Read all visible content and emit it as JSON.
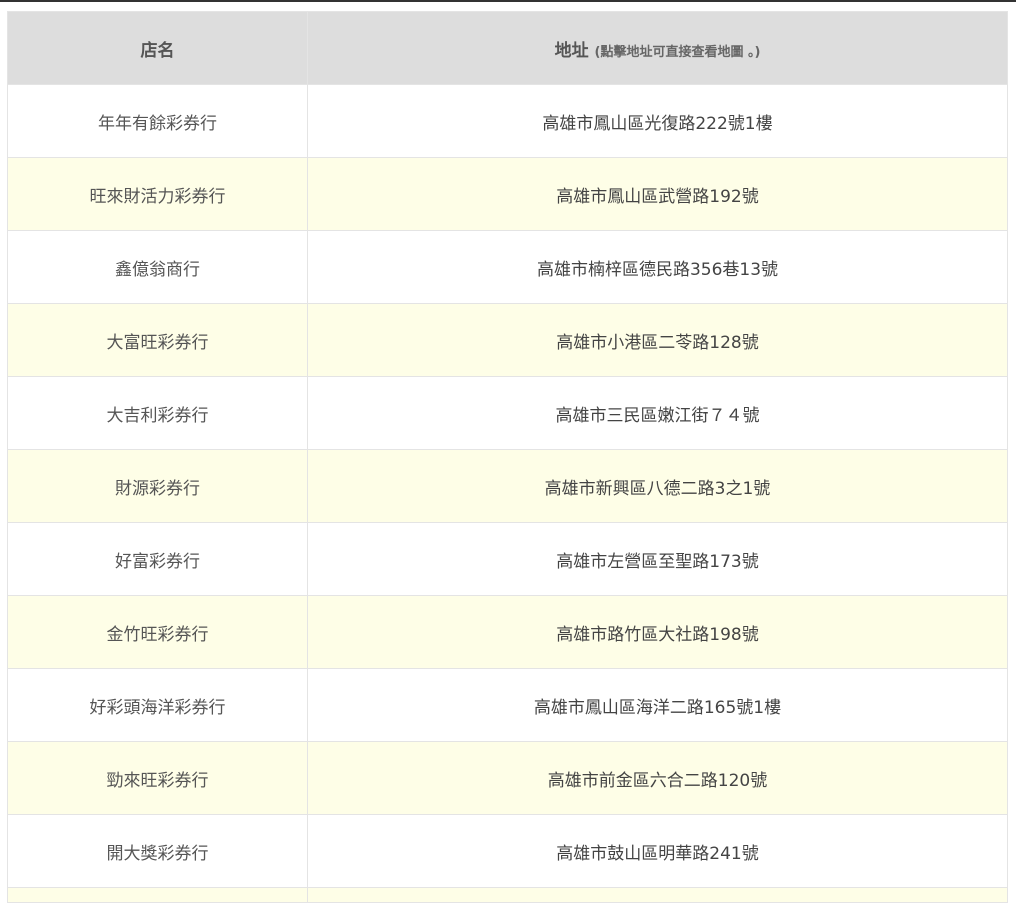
{
  "table": {
    "headers": {
      "name": "店名",
      "address": "地址",
      "address_hint": "(點擊地址可直接查看地圖 。)"
    },
    "rows": [
      {
        "name": "年年有餘彩券行",
        "address": "高雄市鳳山區光復路222號1樓"
      },
      {
        "name": "旺來財活力彩券行",
        "address": "高雄市鳳山區武營路192號"
      },
      {
        "name": "鑫億翁商行",
        "address": "高雄市楠梓區德民路356巷13號"
      },
      {
        "name": "大富旺彩券行",
        "address": "高雄市小港區二苓路128號"
      },
      {
        "name": "大吉利彩券行",
        "address": "高雄市三民區嫩江街７４號"
      },
      {
        "name": "財源彩券行",
        "address": "高雄市新興區八德二路3之1號"
      },
      {
        "name": "好富彩券行",
        "address": "高雄市左營區至聖路173號"
      },
      {
        "name": "金竹旺彩券行",
        "address": "高雄市路竹區大社路198號"
      },
      {
        "name": "好彩頭海洋彩券行",
        "address": "高雄市鳳山區海洋二路165號1樓"
      },
      {
        "name": "勁來旺彩券行",
        "address": "高雄市前金區六合二路120號"
      },
      {
        "name": "開大獎彩券行",
        "address": "高雄市鼓山區明華路241號"
      }
    ]
  }
}
